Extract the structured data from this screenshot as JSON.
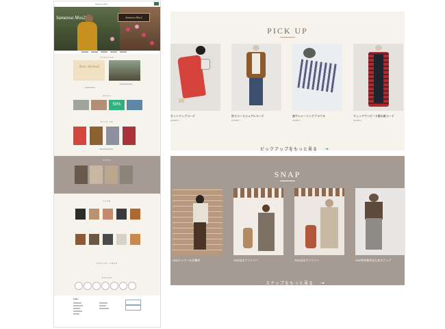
{
  "thumbnail": {
    "header": {
      "logo": "Samansa Mos2",
      "cta_label": ""
    },
    "hero": {
      "title": "Samansa Mos2",
      "sign_text": "Samansa Mos2"
    },
    "sections": {
      "feature": "FEATURE",
      "feature_banner": "New Arrival",
      "news": "NEWS",
      "banner_percent": "50%",
      "pickup": "PICK UP",
      "snap": "SNAP",
      "item": "ITEM",
      "online_shop": "ONLINE SHOP",
      "brand": "BRAND"
    },
    "footer": {
      "company": "Luna"
    }
  },
  "pickup": {
    "title": "PICK UP",
    "cards": [
      {
        "caption": "セットアップコーデ",
        "date": "2018/07/..."
      },
      {
        "caption": "秋カラーカジュアルコーデ",
        "date": "2018/07/..."
      },
      {
        "caption": "爽やシャーリングブラウス",
        "date": "2018/07/..."
      },
      {
        "caption": "チェックワンピース重ね着コーデ",
        "date": "2018/07/..."
      }
    ],
    "more": "ピックアップをもっと見る",
    "arrow": "→"
  },
  "snap": {
    "title": "SNAP",
    "cards": [
      {
        "caption": "SM2テックール大集合"
      },
      {
        "caption": "SM2はるファミリー"
      },
      {
        "caption": "SM2はるファミリー"
      },
      {
        "caption": "SM2秋冬新作まとめスナップ"
      }
    ],
    "more": "スナップをもっと見る",
    "arrow": "→"
  },
  "colors": {
    "accent": "#2f7a4d",
    "panel_bg": "#f6f3ed",
    "snap_bg": "#a59b92",
    "arrow_green": "#3b8a6e"
  }
}
